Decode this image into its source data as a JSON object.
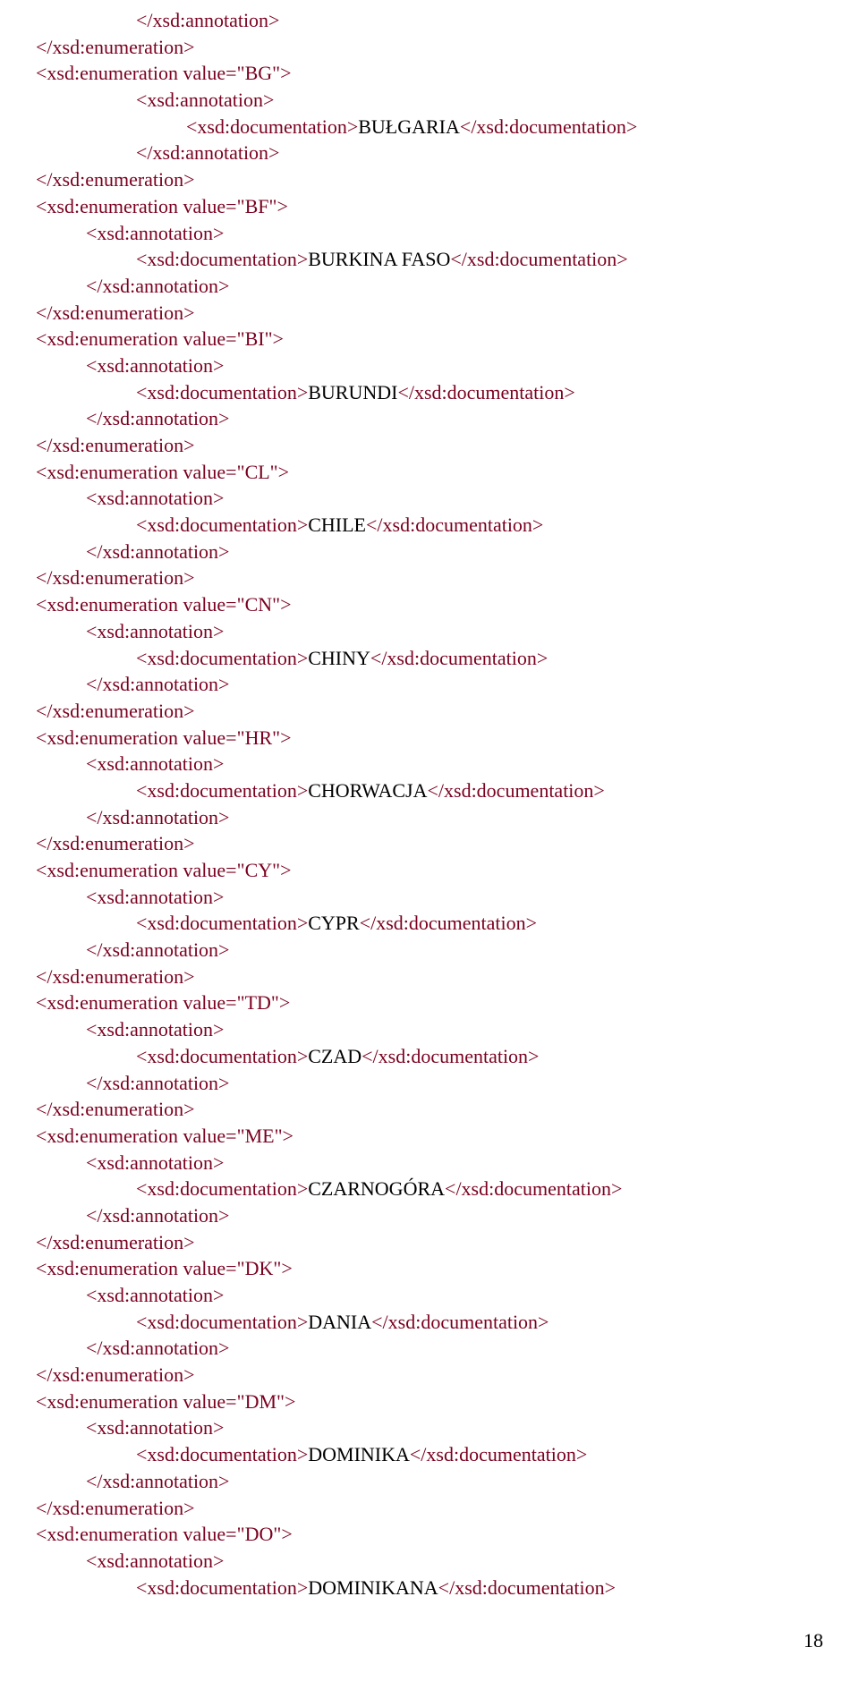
{
  "elements": {
    "annotation_open": "<xsd:annotation>",
    "annotation_close": "</xsd:annotation>",
    "enumeration_close": "</xsd:enumeration>",
    "enumeration_open_prefix": "<xsd:enumeration value=\"",
    "enumeration_open_suffix": "\">",
    "documentation_open": "<xsd:documentation>",
    "documentation_close": "</xsd:documentation>"
  },
  "lead": {
    "annotation_close_indent": 2,
    "enumeration_close_indent": 0
  },
  "first_block": {
    "value": "BG",
    "text": "BUŁGARIA",
    "indent_enum": 0,
    "indent_ann": 2,
    "indent_doc": 3
  },
  "blocks": [
    {
      "value": "BF",
      "text": "BURKINA FASO"
    },
    {
      "value": "BI",
      "text": "BURUNDI"
    },
    {
      "value": "CL",
      "text": "CHILE"
    },
    {
      "value": "CN",
      "text": "CHINY"
    },
    {
      "value": "HR",
      "text": "CHORWACJA"
    },
    {
      "value": "CY",
      "text": "CYPR"
    },
    {
      "value": "TD",
      "text": "CZAD"
    },
    {
      "value": "ME",
      "text": "CZARNOGÓRA"
    },
    {
      "value": "DK",
      "text": "DANIA"
    },
    {
      "value": "DM",
      "text": "DOMINIKA"
    }
  ],
  "last_block": {
    "value": "DO",
    "text": "DOMINIKANA"
  },
  "page_number": "18"
}
